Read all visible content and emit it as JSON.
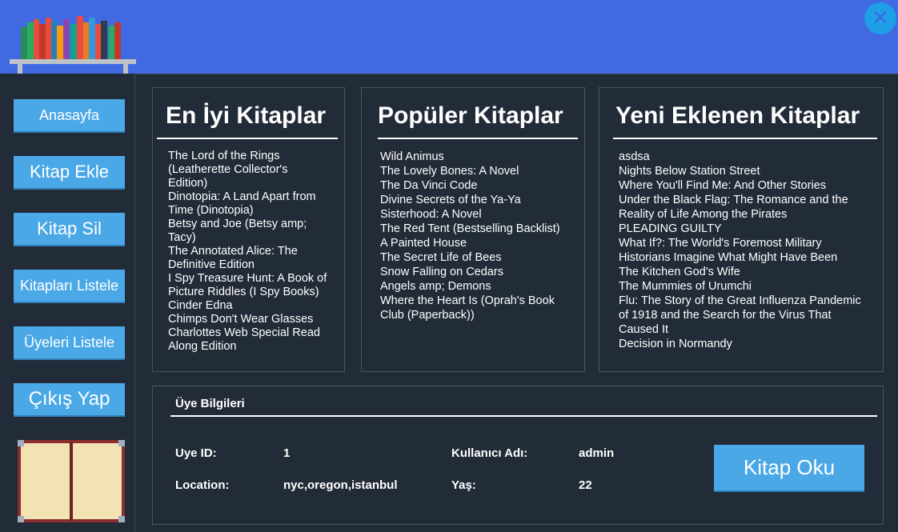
{
  "header": {
    "close_label": "✕"
  },
  "sidebar": {
    "buttons": [
      {
        "label": "Anasayfa"
      },
      {
        "label": "Kitap Ekle"
      },
      {
        "label": "Kitap Sil"
      },
      {
        "label": "Kitapları Listele"
      },
      {
        "label": "Üyeleri Listele"
      },
      {
        "label": "Çıkış Yap"
      }
    ]
  },
  "panels": {
    "best": {
      "title": "En İyi Kitaplar",
      "items": [
        "The Lord of the Rings",
        "(Leatherette Collector's",
        "Edition)",
        "Dinotopia: A Land Apart from",
        "Time (Dinotopia)",
        "Betsy and Joe (Betsy amp;",
        "Tacy)",
        "The Annotated Alice: The",
        "Definitive Edition",
        "I Spy Treasure Hunt: A Book of",
        "Picture Riddles (I Spy Books)",
        "Cinder Edna",
        "Chimps Don't Wear Glasses",
        "Charlottes Web Special Read",
        "Along Edition"
      ]
    },
    "popular": {
      "title": "Popüler Kitaplar",
      "items": [
        "Wild Animus",
        "The Lovely Bones: A Novel",
        "The Da Vinci Code",
        "Divine Secrets of the Ya-Ya",
        "Sisterhood: A Novel",
        "The Red Tent (Bestselling Backlist)",
        "A Painted House",
        "The Secret Life of Bees",
        "Snow Falling on Cedars",
        "Angels amp; Demons",
        "Where the Heart Is (Oprah's Book",
        "Club (Paperback))"
      ]
    },
    "new": {
      "title": "Yeni Eklenen Kitaplar",
      "items": [
        "asdsa",
        "Nights Below Station Street",
        "Where You'll Find Me: And Other Stories",
        "Under the Black Flag: The Romance and the",
        "Reality of Life Among the Pirates",
        "PLEADING GUILTY",
        "What If?: The World's Foremost Military",
        "Historians Imagine What Might Have Been",
        "The Kitchen God's Wife",
        "The Mummies of Urumchi",
        "Flu: The Story of the Great Influenza Pandemic",
        "of 1918 and the Search for the Virus That",
        "Caused It",
        "Decision in Normandy"
      ]
    }
  },
  "member": {
    "title": "Üye Bilgileri",
    "id_label": "Uye ID:",
    "id_value": "1",
    "location_label": "Location:",
    "location_value": "nyc,oregon,istanbul",
    "username_label": "Kullanıcı Adı:",
    "username_value": "admin",
    "age_label": "Yaş:",
    "age_value": "22",
    "read_button": "Kitap Oku"
  }
}
